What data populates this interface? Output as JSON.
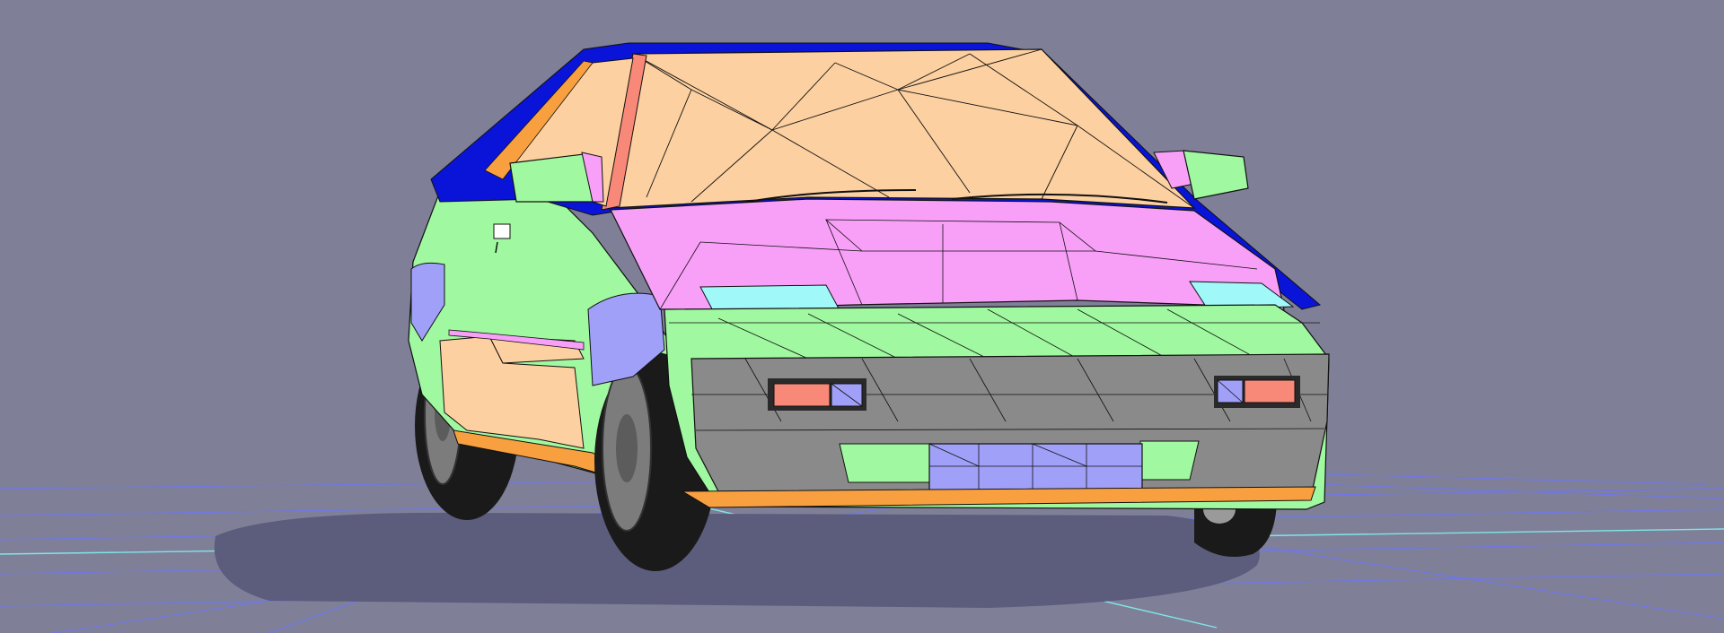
{
  "scene": {
    "subject": "3d-car-wireframe-model",
    "colors": {
      "background": "#7f8098",
      "grid_line": "#6f76e6",
      "grid_axis": "#7fe6e6",
      "shadow": "#5c5c7c",
      "roof_blue": "#0a14d8",
      "peach": "#fcd0a0",
      "pink": "#f8a0f8",
      "green": "#a0f8a0",
      "cyan": "#a0f8f8",
      "periwinkle": "#a0a0f8",
      "orange": "#f8a040",
      "salmon": "#f88878",
      "gray_bumper": "#8a8a8a",
      "tire": "#1a1a1a",
      "rim": "#7c7c7c"
    }
  }
}
